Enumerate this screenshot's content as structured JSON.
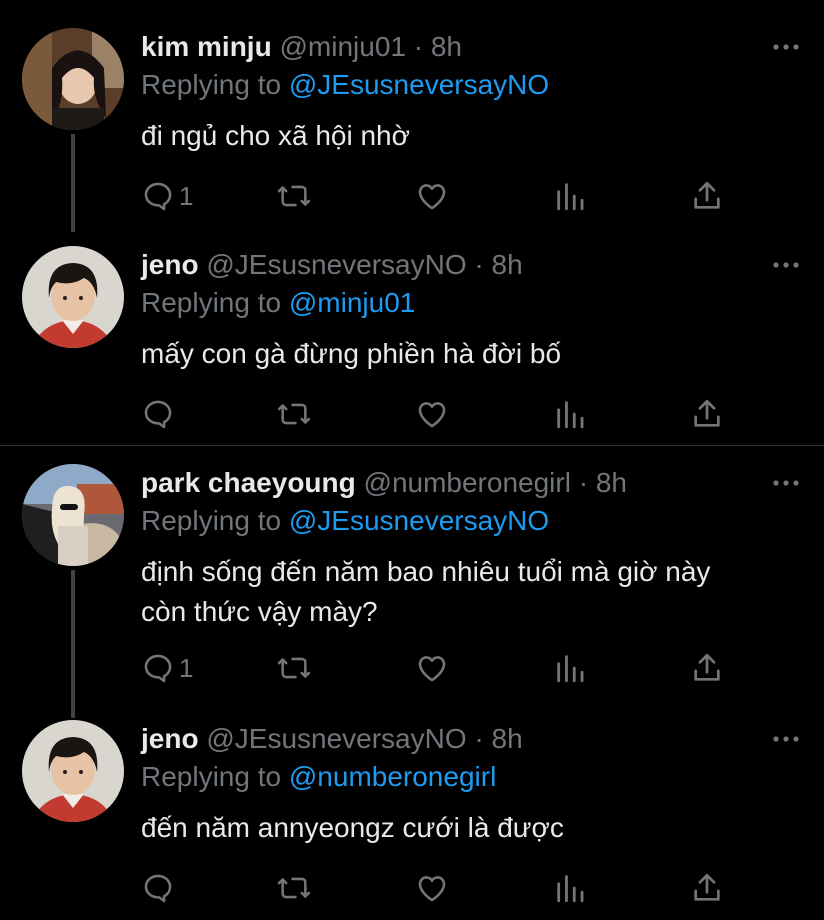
{
  "tweets": [
    {
      "name": "kim minju",
      "handle": "@minju01",
      "time": "8h",
      "replying_label": "Replying to",
      "replying_to": "@JEsusneversayNO",
      "text": "đi ngủ cho xã hội nhờ",
      "reply_count": "1",
      "avatar": "woman-portrait"
    },
    {
      "name": "jeno",
      "handle": "@JEsusneversayNO",
      "time": "8h",
      "replying_label": "Replying to",
      "replying_to": "@minju01",
      "text": "mấy con gà đừng phiền hà đời bố",
      "reply_count": "",
      "avatar": "boy-portrait"
    },
    {
      "name": "park chaeyoung",
      "handle": "@numberonegirl",
      "time": "8h",
      "replying_label": "Replying to",
      "replying_to": "@JEsusneversayNO",
      "text": "định sống đến năm bao nhiêu tuổi mà giờ này còn thức vậy mày?",
      "reply_count": "1",
      "avatar": "blonde-woman-in-car"
    },
    {
      "name": "jeno",
      "handle": "@JEsusneversayNO",
      "time": "8h",
      "replying_label": "Replying to",
      "replying_to": "@numberonegirl",
      "text": "đến năm annyeongz cưới là được",
      "reply_count": "",
      "avatar": "boy-portrait"
    }
  ],
  "separator": "·",
  "icons": [
    "reply-icon",
    "retweet-icon",
    "like-icon",
    "analytics-icon",
    "share-icon",
    "more-icon"
  ],
  "colors": {
    "background": "#000000",
    "name": "#e7e9ea",
    "muted": "#71767b",
    "mention": "#1d9bf0",
    "thread_line": "#3e4246",
    "divider": "#2f3336"
  }
}
